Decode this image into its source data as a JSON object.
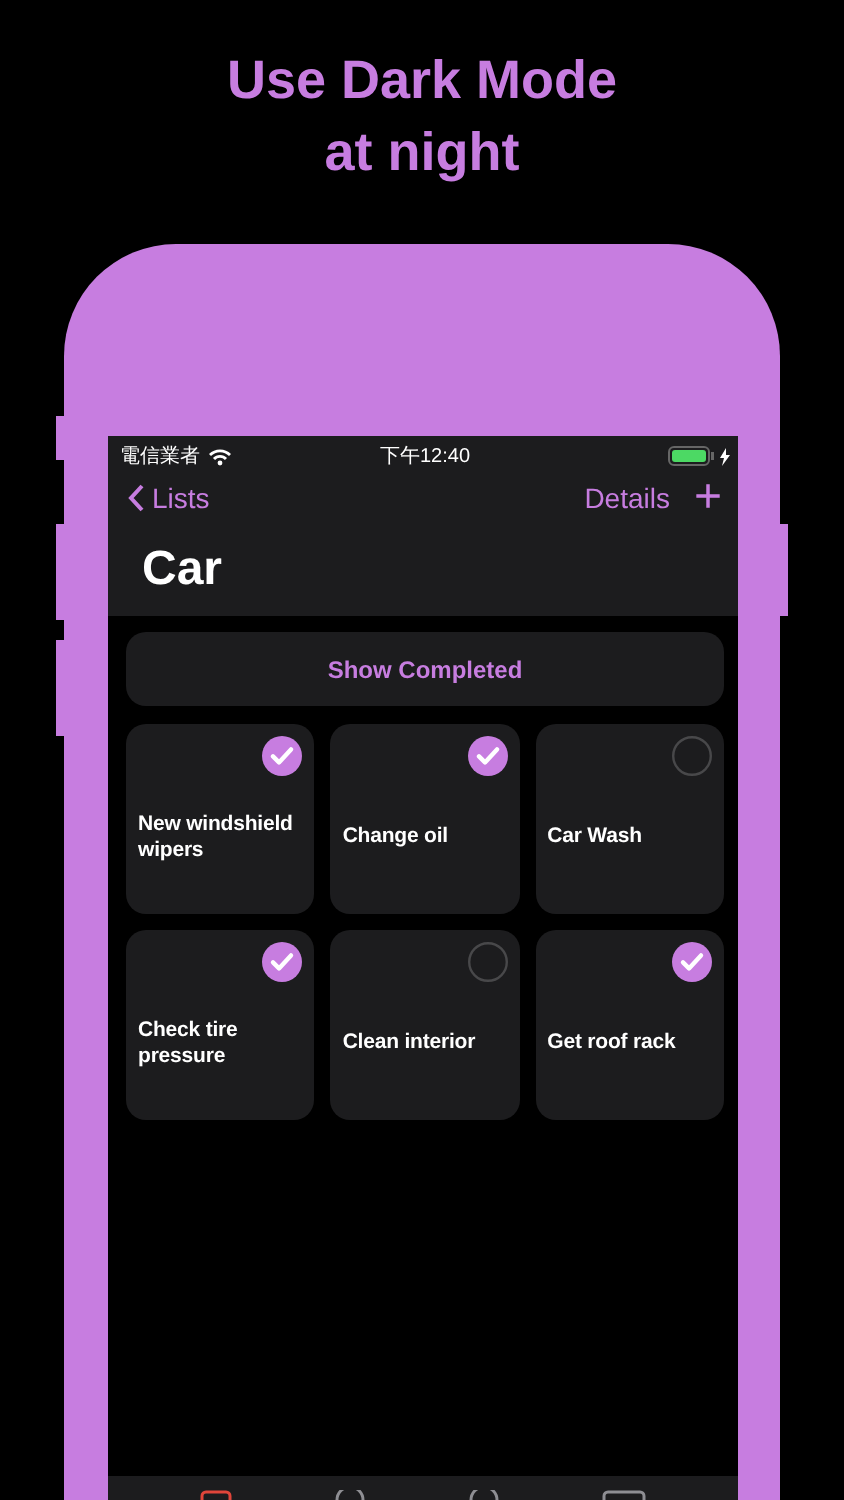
{
  "headline": [
    "Use Dark Mode",
    "at night"
  ],
  "status_bar": {
    "carrier": "電信業者",
    "time": "下午12:40"
  },
  "nav": {
    "back": "Lists",
    "action": "Details",
    "add": "+",
    "title": "Car"
  },
  "show_completed": "Show Completed",
  "items": [
    {
      "title": "New windshield wipers",
      "checked": true
    },
    {
      "title": "Change oil",
      "checked": true
    },
    {
      "title": "Car Wash",
      "checked": false
    },
    {
      "title": "Check tire pressure",
      "checked": true
    },
    {
      "title": "Clean interior",
      "checked": false
    },
    {
      "title": "Get roof rack",
      "checked": true
    }
  ]
}
